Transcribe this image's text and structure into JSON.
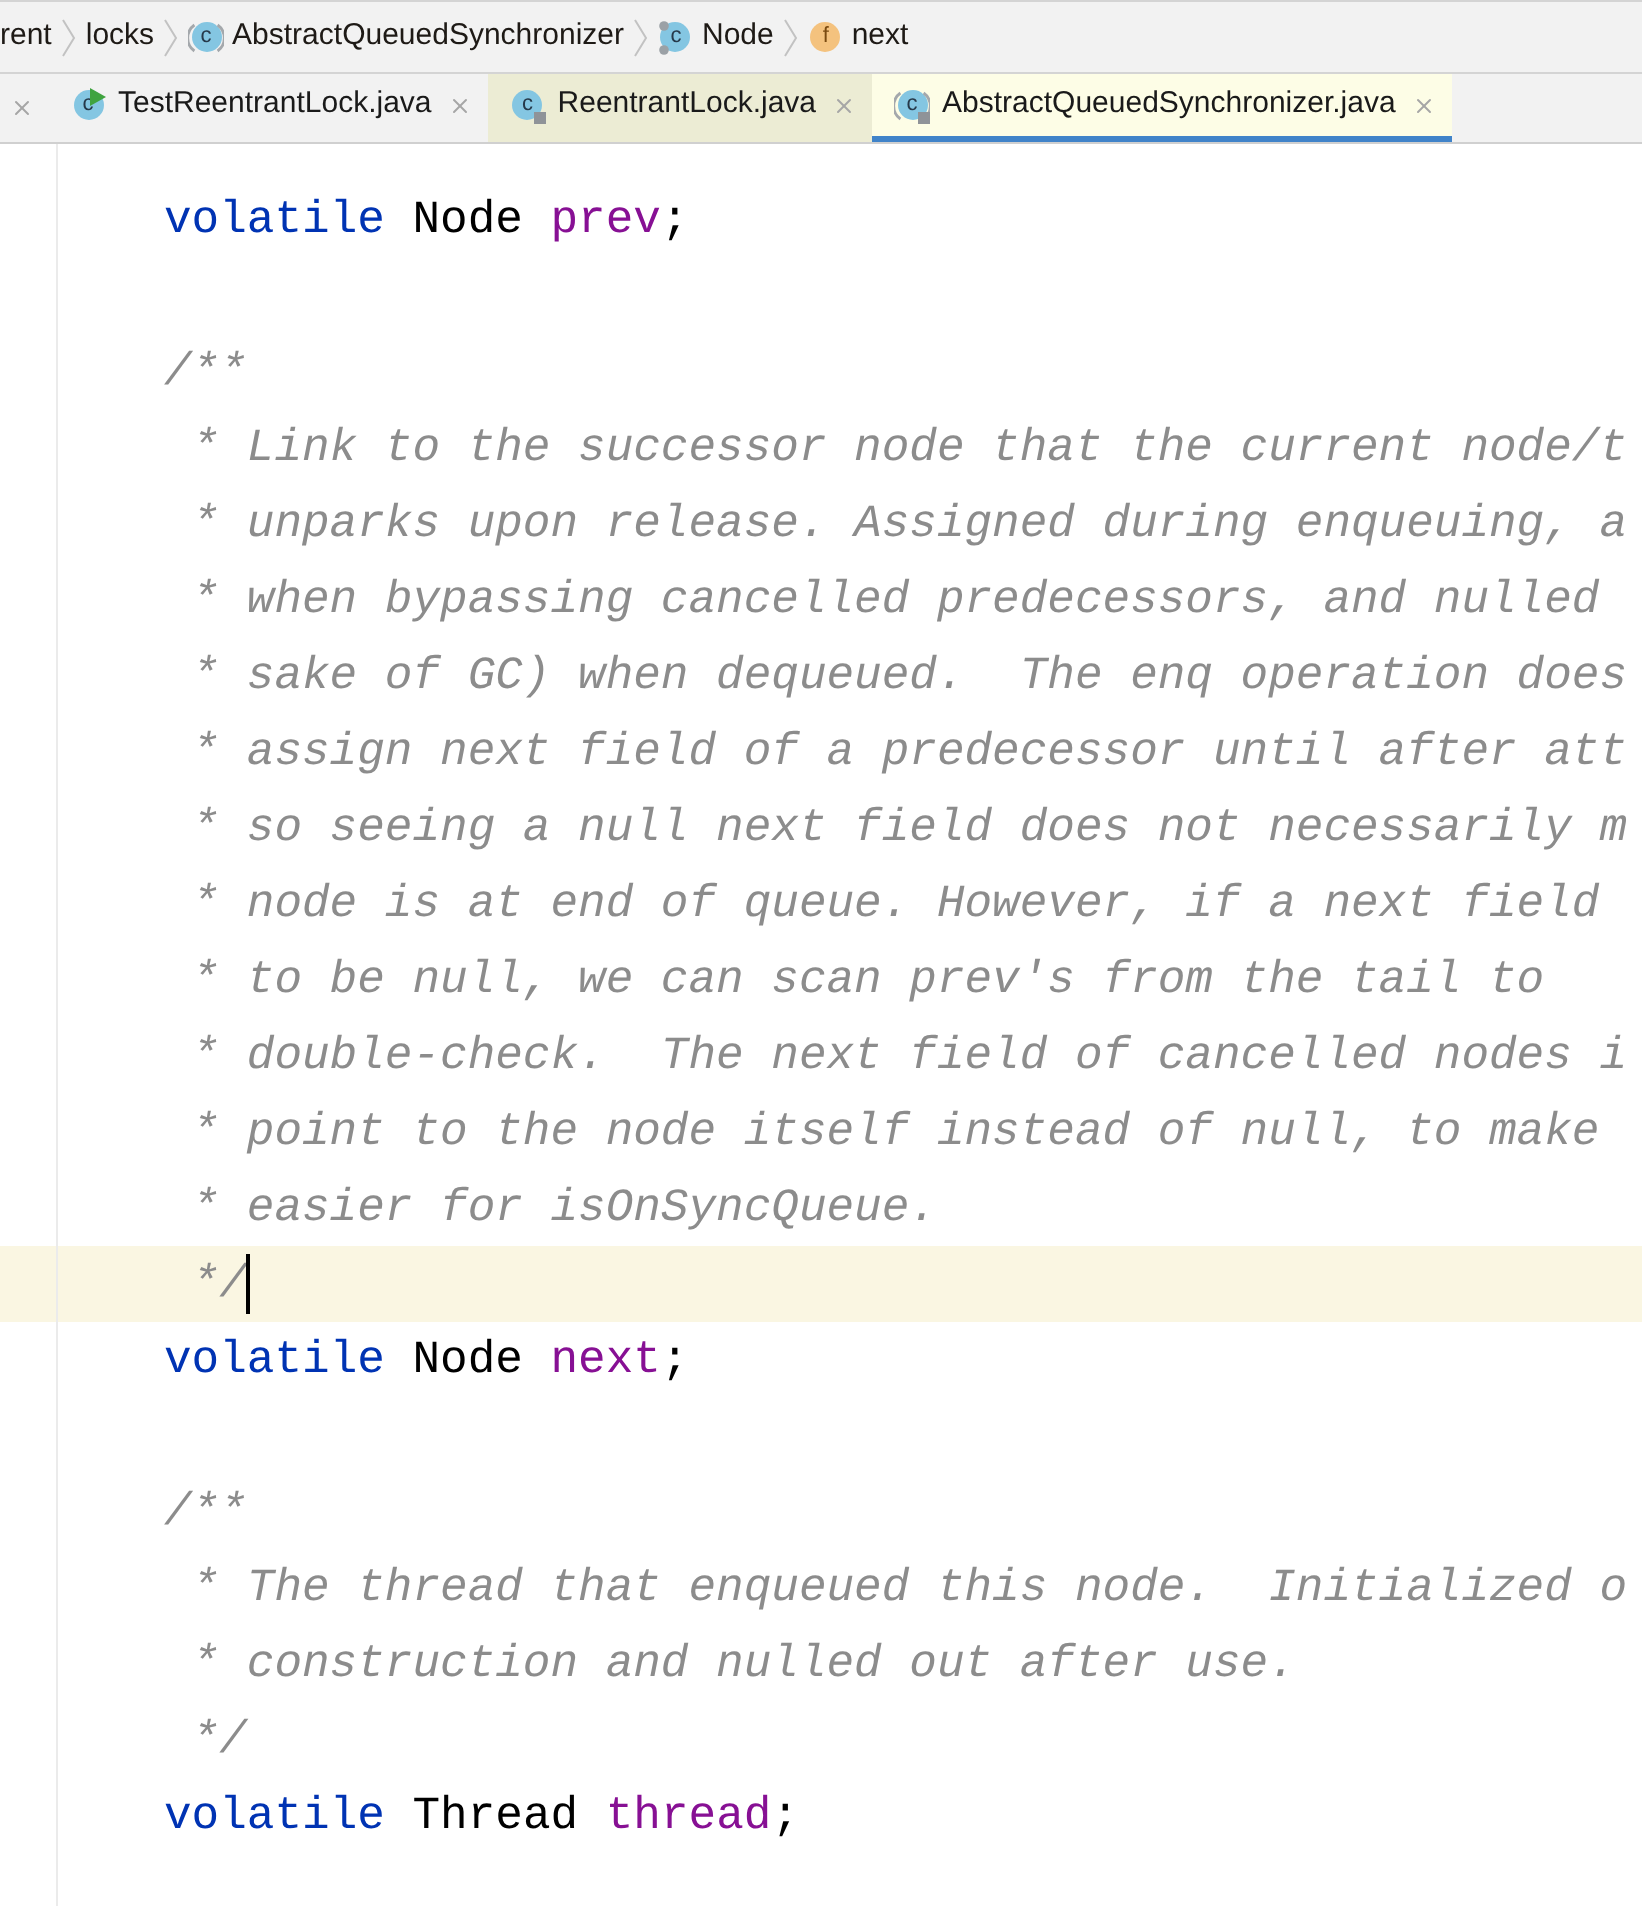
{
  "breadcrumbs": [
    {
      "label": "rent"
    },
    {
      "label": "locks"
    },
    {
      "label": "AbstractQueuedSynchronizer",
      "icon": {
        "kind": "abstract_class",
        "letter": "c"
      }
    },
    {
      "label": "Node",
      "icon": {
        "kind": "static_class",
        "letter": "c"
      }
    },
    {
      "label": "next",
      "icon": {
        "kind": "field",
        "letter": "f"
      }
    }
  ],
  "tabs": [
    {
      "label": "TestReentrantLock.java",
      "icon": {
        "kind": "runnable_class",
        "letter": "c"
      },
      "color": "#f2f2f2",
      "selected": false
    },
    {
      "label": "ReentrantLock.java",
      "icon": {
        "kind": "readonly_class",
        "letter": "c"
      },
      "color": "#ececd4",
      "selected": false
    },
    {
      "label": "AbstractQueuedSynchronizer.java",
      "icon": {
        "kind": "readonly_abstract_class",
        "letter": "c"
      },
      "color": "#fdfde6",
      "selected": true
    }
  ],
  "editor": {
    "lines": [
      {
        "kind": "code",
        "current": false,
        "tokens": [
          {
            "text": "volatile ",
            "kind": "keyword"
          },
          {
            "text": "Node ",
            "kind": "type"
          },
          {
            "text": "prev",
            "kind": "field"
          },
          {
            "text": ";",
            "kind": "plain"
          }
        ]
      },
      {
        "kind": "blank",
        "current": false
      },
      {
        "kind": "doc_start",
        "text": "/**",
        "current": false
      },
      {
        "kind": "doc",
        "text": "* Link to the successor node that the current node/t",
        "current": false
      },
      {
        "kind": "doc",
        "text": "* unparks upon release. Assigned during enqueuing, a",
        "current": false
      },
      {
        "kind": "doc",
        "text": "* when bypassing cancelled predecessors, and nulled",
        "current": false
      },
      {
        "kind": "doc",
        "text": "* sake of GC) when dequeued.  The enq operation does",
        "current": false
      },
      {
        "kind": "doc",
        "text": "* assign next field of a predecessor until after att",
        "current": false
      },
      {
        "kind": "doc",
        "text": "* so seeing a null next field does not necessarily m",
        "current": false
      },
      {
        "kind": "doc",
        "text": "* node is at end of queue. However, if a next field",
        "current": false
      },
      {
        "kind": "doc",
        "text": "* to be null, we can scan prev's from the tail to",
        "current": false
      },
      {
        "kind": "doc",
        "text": "* double-check.  The next field of cancelled nodes i",
        "current": false
      },
      {
        "kind": "doc",
        "text": "* point to the node itself instead of null, to make",
        "current": false
      },
      {
        "kind": "doc",
        "text": "* easier for isOnSyncQueue.",
        "current": false
      },
      {
        "kind": "doc",
        "text": "*/",
        "current": true
      },
      {
        "kind": "code",
        "current": false,
        "tokens": [
          {
            "text": "volatile ",
            "kind": "keyword"
          },
          {
            "text": "Node ",
            "kind": "type"
          },
          {
            "text": "next",
            "kind": "field"
          },
          {
            "text": ";",
            "kind": "plain"
          }
        ]
      },
      {
        "kind": "blank",
        "current": false
      },
      {
        "kind": "doc_start",
        "text": "/**",
        "current": false
      },
      {
        "kind": "doc",
        "text": "* The thread that enqueued this node.  Initialized o",
        "current": false
      },
      {
        "kind": "doc",
        "text": "* construction and nulled out after use.",
        "current": false
      },
      {
        "kind": "doc",
        "text": "*/",
        "current": false
      },
      {
        "kind": "code",
        "current": false,
        "tokens": [
          {
            "text": "volatile ",
            "kind": "keyword"
          },
          {
            "text": "Thread ",
            "kind": "type"
          },
          {
            "text": "thread",
            "kind": "field"
          },
          {
            "text": ";",
            "kind": "plain"
          }
        ]
      }
    ]
  }
}
